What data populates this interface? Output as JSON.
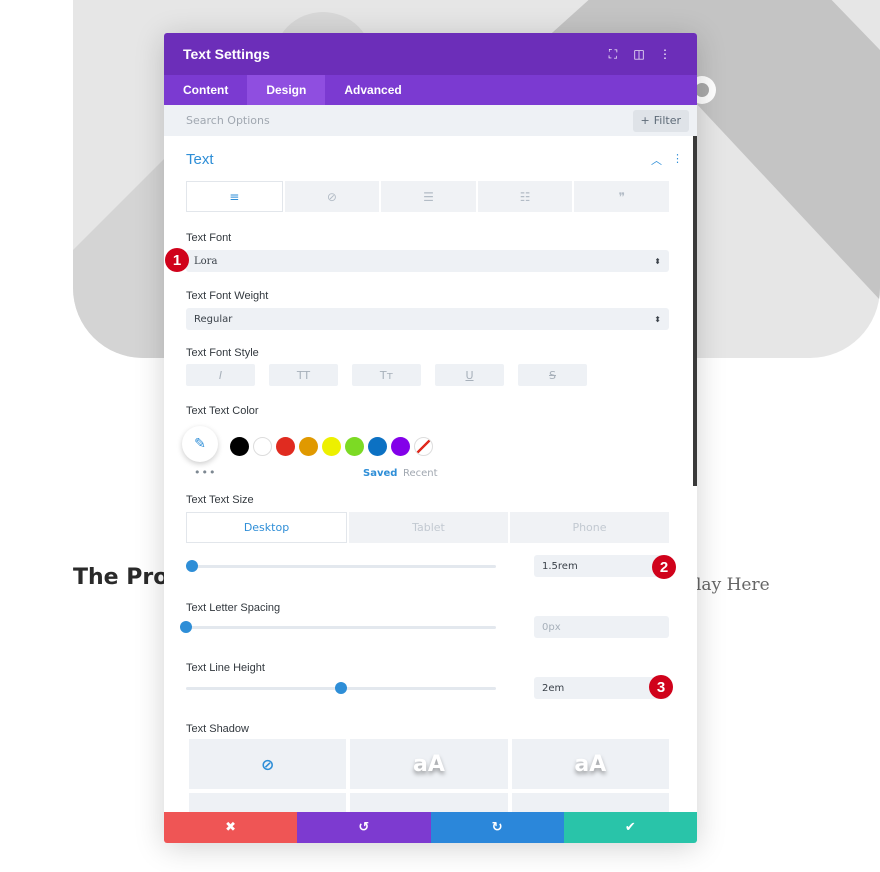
{
  "background": {
    "title_fragment": "The Pro",
    "subtitle_fragment": "lay Here"
  },
  "modal": {
    "title": "Text Settings",
    "header_icons": [
      "expand-icon",
      "split-view-icon",
      "more-icon"
    ],
    "tabs": [
      {
        "label": "Content",
        "active": false
      },
      {
        "label": "Design",
        "active": true
      },
      {
        "label": "Advanced",
        "active": false
      }
    ],
    "search": {
      "placeholder": "Search Options",
      "filter_label": "Filter"
    },
    "section_title": "Text",
    "align_tabs": [
      "align-left-icon",
      "link-off-icon",
      "list-unordered-icon",
      "list-ordered-icon",
      "blockquote-icon"
    ],
    "text_font": {
      "label": "Text Font",
      "value": "Lora"
    },
    "text_font_weight": {
      "label": "Text Font Weight",
      "value": "Regular"
    },
    "text_font_style": {
      "label": "Text Font Style",
      "buttons": [
        "I",
        "TT",
        "Tт",
        "U",
        "S"
      ]
    },
    "text_color": {
      "label": "Text Text Color",
      "swatches": [
        "#000000",
        "#ffffff",
        "#e02b20",
        "#e09900",
        "#edf000",
        "#7cda24",
        "#0c71c3",
        "#8300e9"
      ],
      "saved_label": "Saved",
      "recent_label": "Recent"
    },
    "text_size": {
      "label": "Text Text Size",
      "devices": [
        "Desktop",
        "Tablet",
        "Phone"
      ],
      "value": "1.5rem",
      "slider_fraction": 0.02
    },
    "letter_spacing": {
      "label": "Text Letter Spacing",
      "placeholder": "0px",
      "slider_fraction": 0.0
    },
    "line_height": {
      "label": "Text Line Height",
      "value": "2em",
      "slider_fraction": 0.5
    },
    "text_shadow": {
      "label": "Text Shadow",
      "options": [
        "none",
        "aA",
        "aA",
        "",
        "",
        ""
      ]
    }
  },
  "markers": [
    "1",
    "2",
    "3"
  ],
  "footer": [
    "cancel-icon",
    "undo-icon",
    "redo-icon",
    "save-icon"
  ]
}
